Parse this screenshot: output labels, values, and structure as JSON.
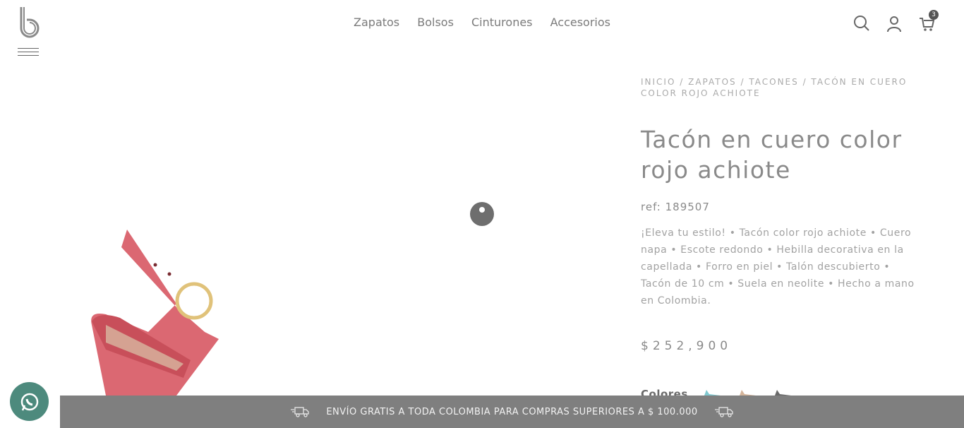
{
  "nav": {
    "items": [
      "Zapatos",
      "Bolsos",
      "Cinturones",
      "Accesorios"
    ]
  },
  "header": {
    "search_icon": "search-icon",
    "account_icon": "user-icon",
    "cart_icon": "cart-icon",
    "cart_count": "3"
  },
  "breadcrumb": {
    "home": "INICIO",
    "sep1": " / ",
    "cat": "ZAPATOS",
    "sep2": " / ",
    "sub": "TACONES",
    "sep3": " / ",
    "current": "TACÓN EN CUERO COLOR ROJO ACHIOTE"
  },
  "product": {
    "title": "Tacón en cuero color rojo achiote",
    "ref": "ref: 189507",
    "description": "¡Eleva tu estilo! • Tacón color rojo achiote • Cuero napa • Escote redondo • Hebilla decorativa en la capellada • Forro en piel • Talón descubierto • Tacón de 10 cm • Suela en neolite • Hecho a mano en Colombia.",
    "price": "$252,900",
    "colors_label": "Colores",
    "swatches": [
      "#7fc8cf",
      "#d4b49a",
      "#6a6a6a"
    ]
  },
  "banner": {
    "text": "ENVÍO GRATIS A TODA COLOMBIA PARA COMPRAS SUPERIORES A $ 100.000"
  },
  "colors": {
    "accent": "#7f7f7f",
    "whatsapp": "#4d8a7d",
    "shoe": "#d9606a"
  }
}
